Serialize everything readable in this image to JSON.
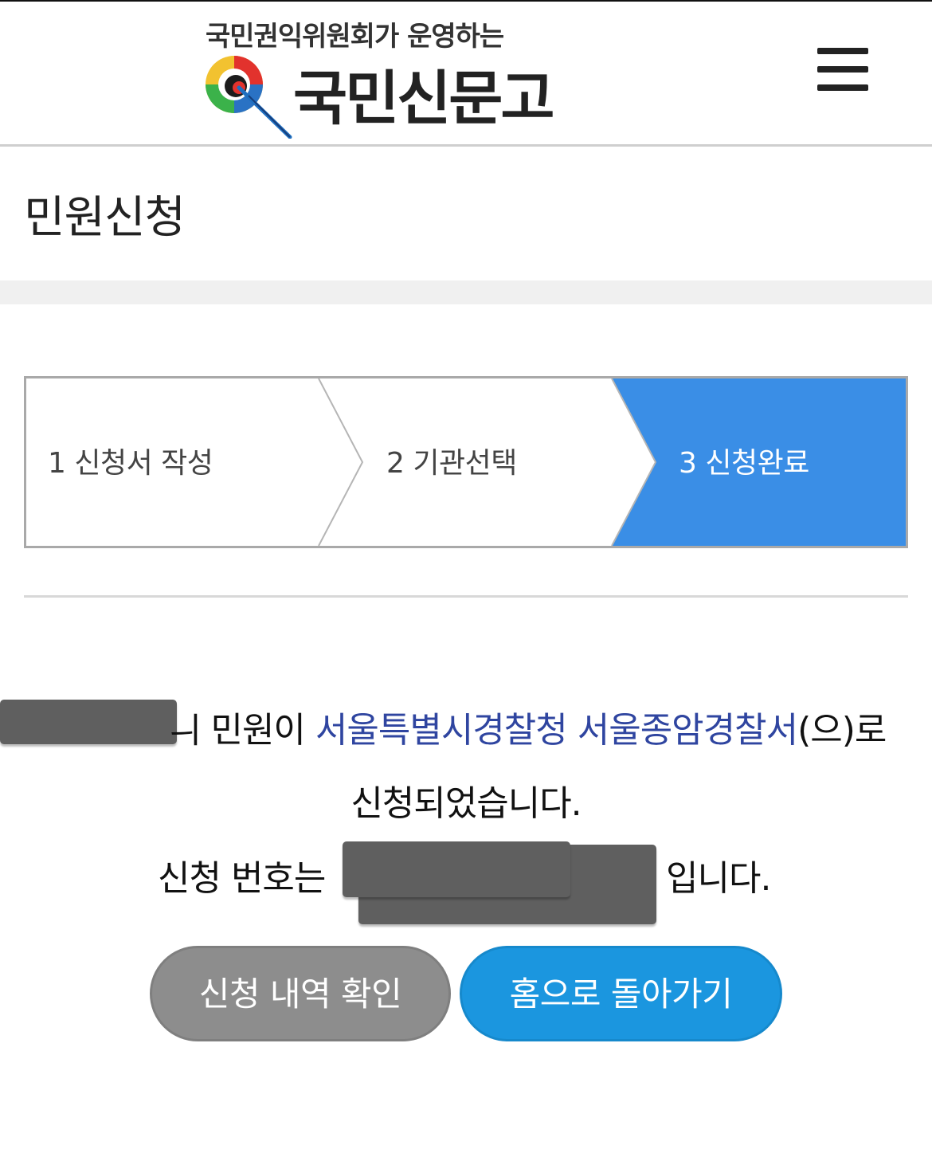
{
  "header": {
    "logo_subtitle": "국민권익위원회가 운영하는",
    "logo_title": "국민신문고",
    "menu_icon": "hamburger-menu-icon"
  },
  "page": {
    "title": "민원신청"
  },
  "steps": [
    {
      "label": "1 신청서 작성",
      "active": false
    },
    {
      "label": "2 기관선택",
      "active": false
    },
    {
      "label": "3 신청완료",
      "active": true
    }
  ],
  "result": {
    "line1_prefix": "ㅢ 민원이 ",
    "organization": "서울특별시경찰청 서울종암경찰서",
    "line1_suffix": "(으)로",
    "line2": "신청되었습니다.",
    "line3_prefix": "신청 번호는",
    "line3_suffix": "입니다."
  },
  "buttons": {
    "history_label": "신청 내역 확인",
    "home_label": "홈으로 돌아가기"
  },
  "colors": {
    "active_step": "#3a8ee6",
    "organization_text": "#2f45a0",
    "history_button": "#8d8d8d",
    "home_button": "#1b96df"
  }
}
